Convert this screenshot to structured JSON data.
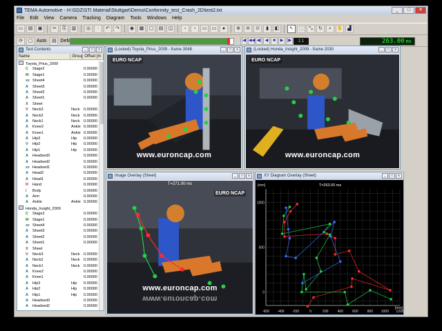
{
  "window": {
    "title": "TEMA Automotive - H:\\SDZ\\STI Material\\Stuttgart\\Demo\\Conformity_test_Crash_2D\\test2.txt",
    "controls": [
      "_",
      "□",
      "✕"
    ]
  },
  "menu": [
    "File",
    "Edit",
    "View",
    "Camera",
    "Tracking",
    "Diagram",
    "Tools",
    "Windows",
    "Help"
  ],
  "toolbar2": {
    "auto_label": "Auto",
    "default_label": "Default",
    "time_value": "263.00",
    "time_unit": "ms",
    "progress_fraction": 0.97,
    "speed_label": "1:1"
  },
  "tree_panel": {
    "title": "Test Contents",
    "columns": [
      "Name",
      "Group",
      "Offset [m"
    ],
    "rows": [
      {
        "icon": "group",
        "name": "Toyota_Prius_2009",
        "group": "",
        "offset": "",
        "indent": 0
      },
      {
        "icon": "C",
        "name": "Stage2",
        "group": "",
        "offset": "0.00000",
        "indent": 1
      },
      {
        "icon": "M",
        "name": "Stage1",
        "group": "",
        "offset": "0.00000",
        "indent": 1
      },
      {
        "icon": "xz",
        "name": "Sheet4",
        "group": "",
        "offset": "0.00000",
        "indent": 1
      },
      {
        "icon": "A",
        "name": "Sheet3",
        "group": "",
        "offset": "0.00000",
        "indent": 1
      },
      {
        "icon": "A",
        "name": "Sheet2",
        "group": "",
        "offset": "0.00000",
        "indent": 1
      },
      {
        "icon": "A",
        "name": "Sheet1",
        "group": "",
        "offset": "0.00000",
        "indent": 1
      },
      {
        "icon": "X",
        "name": "Sheet",
        "group": "",
        "offset": "",
        "indent": 1
      },
      {
        "icon": "V",
        "name": "Neck3",
        "group": "Neck",
        "offset": "0.00000",
        "indent": 1
      },
      {
        "icon": "A",
        "name": "Neck2",
        "group": "Neck",
        "offset": "0.00000",
        "indent": 1
      },
      {
        "icon": "A",
        "name": "Neck1",
        "group": "Neck",
        "offset": "0.00000",
        "indent": 1
      },
      {
        "icon": "A",
        "name": "Knee2",
        "group": "Ankle",
        "offset": "0.00000",
        "indent": 1
      },
      {
        "icon": "A",
        "name": "Knee1",
        "group": "Ankle",
        "offset": "0.00000",
        "indent": 1
      },
      {
        "icon": "A",
        "name": "Hip3",
        "group": "Hip",
        "offset": "0.00000",
        "indent": 1
      },
      {
        "icon": "V",
        "name": "Hip2",
        "group": "Hip",
        "offset": "0.00000",
        "indent": 1
      },
      {
        "icon": "A",
        "name": "Hip1",
        "group": "Hip",
        "offset": "0.00000",
        "indent": 1
      },
      {
        "icon": "A",
        "name": "Headsed3",
        "group": "",
        "offset": "0.00000",
        "indent": 1
      },
      {
        "icon": "A",
        "name": "Headsed2",
        "group": "",
        "offset": "0.00000",
        "indent": 1
      },
      {
        "icon": "xz",
        "name": "Headsed1",
        "group": "",
        "offset": "0.00000",
        "indent": 1
      },
      {
        "icon": "A",
        "name": "Head2",
        "group": "",
        "offset": "0.00000",
        "indent": 1
      },
      {
        "icon": "A",
        "name": "Head1",
        "group": "",
        "offset": "0.00000",
        "indent": 1
      },
      {
        "icon": "H",
        "name": "Hand",
        "group": "",
        "offset": "0.00000",
        "indent": 1
      },
      {
        "icon": "/",
        "name": "Body",
        "group": "",
        "offset": "0.00000",
        "indent": 1
      },
      {
        "icon": "A",
        "name": "Arm",
        "group": "",
        "offset": "0.00000",
        "indent": 1
      },
      {
        "icon": "A",
        "name": "Ankle",
        "group": "Ankle",
        "offset": "0.00000",
        "indent": 1
      },
      {
        "icon": "group",
        "name": "Honda_Insight_2009",
        "group": "",
        "offset": "",
        "indent": 0
      },
      {
        "icon": "C",
        "name": "Stage2",
        "group": "",
        "offset": "0.00000",
        "indent": 1
      },
      {
        "icon": "M",
        "name": "Stage1",
        "group": "",
        "offset": "0.00000",
        "indent": 1
      },
      {
        "icon": "xz",
        "name": "Sheet4",
        "group": "",
        "offset": "0.00000",
        "indent": 1
      },
      {
        "icon": "A",
        "name": "Sheet3",
        "group": "",
        "offset": "0.00000",
        "indent": 1
      },
      {
        "icon": "A",
        "name": "Sheet2",
        "group": "",
        "offset": "0.00000",
        "indent": 1
      },
      {
        "icon": "A",
        "name": "Sheet1",
        "group": "",
        "offset": "0.00000",
        "indent": 1
      },
      {
        "icon": "X",
        "name": "Sheet",
        "group": "",
        "offset": "",
        "indent": 1
      },
      {
        "icon": "V",
        "name": "Neck3",
        "group": "Neck",
        "offset": "0.00000",
        "indent": 1
      },
      {
        "icon": "A",
        "name": "Neck2",
        "group": "Neck",
        "offset": "0.00000",
        "indent": 1
      },
      {
        "icon": "A",
        "name": "Neck1",
        "group": "Neck",
        "offset": "0.00000",
        "indent": 1
      },
      {
        "icon": "A",
        "name": "Knee2",
        "group": "",
        "offset": "0.00000",
        "indent": 1
      },
      {
        "icon": "A",
        "name": "Knee1",
        "group": "",
        "offset": "0.00000",
        "indent": 1
      },
      {
        "icon": "A",
        "name": "Hip3",
        "group": "Hip",
        "offset": "0.00000",
        "indent": 1
      },
      {
        "icon": "A",
        "name": "Hip2",
        "group": "Hip",
        "offset": "0.00000",
        "indent": 1
      },
      {
        "icon": "A",
        "name": "Hip1",
        "group": "Hip",
        "offset": "0.00000",
        "indent": 1
      },
      {
        "icon": "A",
        "name": "Headsed3",
        "group": "",
        "offset": "0.00000",
        "indent": 1
      },
      {
        "icon": "A",
        "name": "Headsed2",
        "group": "",
        "offset": "0.00000",
        "indent": 1
      }
    ]
  },
  "views": {
    "prius": {
      "title": "(Locked) Toyota_Prius_2009 - frame 3048",
      "watermark": "www.euroncap.com",
      "logo": "EURO NCAP"
    },
    "honda": {
      "title": "(Locked) Honda_Insight_2009 - frame 2030",
      "watermark": "www.euroncap.com",
      "logo": "EURO NCAP"
    },
    "overlay": {
      "title": "Image Overlay (Sheet)",
      "time": "T=271.00 ms",
      "watermark": "www.euroncap.com",
      "logo": "EURO NCAP"
    },
    "xy": {
      "title": "XY Diagram Overlay (Sheet)",
      "time": "T=263.00 ms"
    }
  },
  "chart_data": {
    "type": "scatter",
    "title": "",
    "xlabel": "",
    "ylabel": "",
    "x_unit": "[mm]",
    "y_unit": "[mm]",
    "xlim": [
      -600,
      1200
    ],
    "ylim": [
      -150,
      1150
    ],
    "xticks": [
      -600,
      -400,
      -200,
      0,
      200,
      400,
      600,
      800,
      1000,
      1200
    ],
    "yticks": [
      0,
      500,
      1000
    ],
    "grid": true,
    "series": [
      {
        "color": "#ff2a2a",
        "points": [
          [
            -180,
            980
          ],
          [
            -270,
            900
          ],
          [
            -350,
            780
          ],
          [
            -350,
            620
          ],
          [
            220,
            650
          ],
          [
            330,
            600
          ],
          [
            330,
            420
          ],
          [
            520,
            460
          ],
          [
            650,
            230
          ],
          [
            1070,
            20
          ],
          [
            560,
            150
          ],
          [
            550,
            60
          ],
          [
            40,
            -60
          ],
          [
            -40,
            -160
          ]
        ]
      },
      {
        "color": "#22d14a",
        "points": [
          [
            -280,
            950
          ],
          [
            -360,
            850
          ],
          [
            -380,
            650
          ],
          [
            260,
            760
          ],
          [
            180,
            670
          ],
          [
            260,
            640
          ],
          [
            80,
            380
          ],
          [
            140,
            230
          ],
          [
            -60,
            30
          ],
          [
            -90,
            200
          ],
          [
            -120,
            0
          ],
          [
            460,
            0
          ],
          [
            500,
            -140
          ],
          [
            800,
            20
          ],
          [
            1080,
            -80
          ]
        ]
      },
      {
        "color": "#3a6dff",
        "points": [
          [
            -330,
            940
          ],
          [
            -300,
            700
          ],
          [
            -280,
            600
          ],
          [
            -330,
            400
          ],
          [
            -200,
            380
          ],
          [
            320,
            780
          ],
          [
            270,
            620
          ],
          [
            400,
            340
          ],
          [
            -110,
            100
          ]
        ]
      }
    ]
  },
  "colors": {
    "accent": "#3a6fb5",
    "marker_red": "#ff2a2a",
    "marker_green": "#22d14a",
    "progress": "#4a9d3a",
    "time_digits": "#33ff33"
  }
}
